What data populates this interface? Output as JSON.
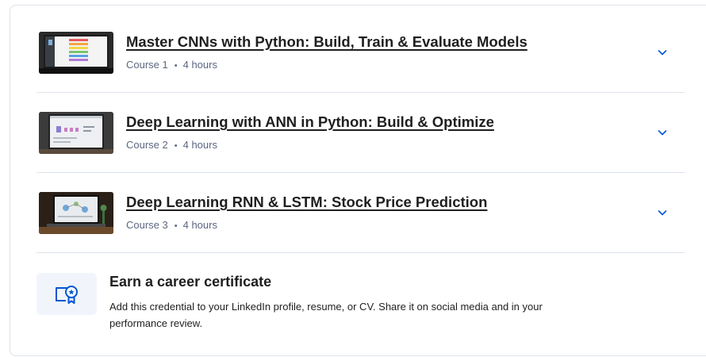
{
  "courses": [
    {
      "title": "Master CNNs with Python: Build, Train & Evaluate Models",
      "course_label": "Course 1",
      "duration": "4 hours"
    },
    {
      "title": "Deep Learning with ANN in Python: Build & Optimize",
      "course_label": "Course 2",
      "duration": "4 hours"
    },
    {
      "title": "Deep Learning RNN & LSTM: Stock Price Prediction",
      "course_label": "Course 3",
      "duration": "4 hours"
    }
  ],
  "separator": "•",
  "certificate": {
    "title": "Earn a career certificate",
    "description": "Add this credential to your LinkedIn profile, resume, or CV. Share it on social media and in your performance review."
  },
  "colors": {
    "accent": "#0056d2",
    "meta_text": "#5b6780",
    "border": "#dce3ec",
    "icon_bg": "#f1f5fb"
  },
  "icons": {
    "chevron": "chevron-down-icon",
    "certificate": "certificate-icon"
  }
}
